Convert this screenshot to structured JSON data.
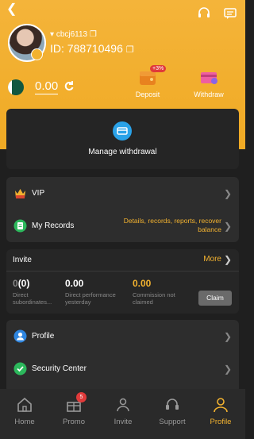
{
  "colors": {
    "accent": "#f2b230",
    "background": "#1f1f1f",
    "card": "#2d2d2d"
  },
  "user": {
    "name": "cbcj6113",
    "id_label": "ID: 788710496"
  },
  "wallet": {
    "balance": "0.00"
  },
  "quick_actions": {
    "deposit_label": "Deposit",
    "deposit_badge": "+3%",
    "withdraw_label": "Withdraw"
  },
  "manage_withdrawal": {
    "label": "Manage withdrawal"
  },
  "menu1": {
    "vip_label": "VIP",
    "records_label": "My Records",
    "records_hint": "Details, records, reports, recover balance"
  },
  "invite": {
    "title": "Invite",
    "more_label": "More",
    "stats": [
      {
        "value_prefix": "0",
        "value_rest": "(0)",
        "caption": "Direct subordinates..."
      },
      {
        "value": "0.00",
        "caption": "Direct performance yesterday"
      },
      {
        "value": "0.00",
        "caption": "Commission not claimed"
      }
    ],
    "claim_label": "Claim"
  },
  "menu2": {
    "profile_label": "Profile",
    "security_label": "Security Center"
  },
  "bottom_nav": {
    "items": [
      {
        "label": "Home",
        "icon": "home-icon"
      },
      {
        "label": "Promo",
        "icon": "gift-icon",
        "badge": "5"
      },
      {
        "label": "Invite",
        "icon": "invite-icon"
      },
      {
        "label": "Support",
        "icon": "headset-icon"
      },
      {
        "label": "Profile",
        "icon": "person-icon",
        "active": true
      }
    ]
  }
}
